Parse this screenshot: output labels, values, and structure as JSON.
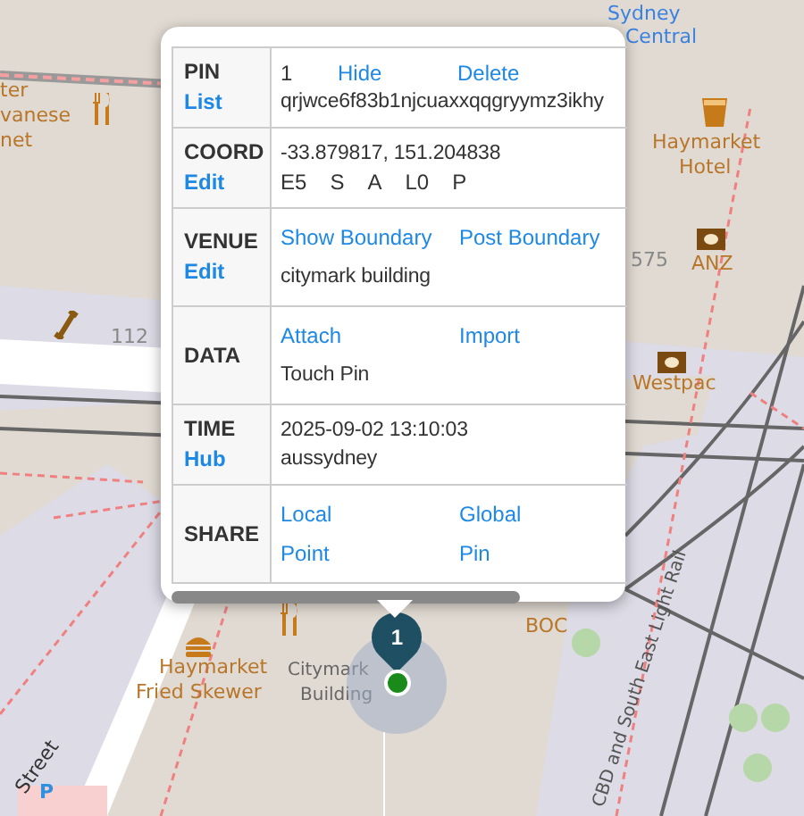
{
  "map_labels": [
    {
      "text": "Sydney",
      "kind": "station"
    },
    {
      "text": "Central",
      "kind": "station"
    },
    {
      "text": "ter",
      "kind": "poi"
    },
    {
      "text": "vanese",
      "kind": "poi"
    },
    {
      "text": "net",
      "kind": "poi"
    },
    {
      "text": "112",
      "kind": "number"
    },
    {
      "text": "Haymarket",
      "kind": "poi"
    },
    {
      "text": "Hotel",
      "kind": "poi"
    },
    {
      "text": "575",
      "kind": "number"
    },
    {
      "text": "ANZ",
      "kind": "poi"
    },
    {
      "text": "Westpac",
      "kind": "poi"
    },
    {
      "text": "BOC",
      "kind": "poi"
    },
    {
      "text": "Haymarket",
      "kind": "poi"
    },
    {
      "text": "Fried Skewer",
      "kind": "poi"
    },
    {
      "text": "Citymark",
      "kind": "building"
    },
    {
      "text": "Building",
      "kind": "building"
    },
    {
      "text": "P",
      "kind": "parking"
    }
  ],
  "street_labels": [
    {
      "text": "Street",
      "kind": "street"
    },
    {
      "text": "CBD and South East Light Rail",
      "kind": "rail"
    }
  ],
  "pin": {
    "number": "1"
  },
  "popup": {
    "rows": [
      {
        "label": "PIN",
        "link": "List",
        "lines": [
          [
            {
              "text": "1",
              "kind": "num"
            },
            {
              "text": "Hide",
              "kind": "action"
            },
            {
              "text": "Delete",
              "kind": "action"
            }
          ],
          [
            {
              "text": "qrjwce6f83b1njcuaxxqqgryymz3ikhy",
              "kind": "text"
            }
          ]
        ]
      },
      {
        "label": "COORD",
        "link": "Edit",
        "lines": [
          [
            {
              "text": "-33.879817, 151.204838",
              "kind": "text"
            }
          ],
          [
            {
              "text": "E5",
              "kind": "code"
            },
            {
              "text": "S",
              "kind": "code"
            },
            {
              "text": "A",
              "kind": "code"
            },
            {
              "text": "L0",
              "kind": "code"
            },
            {
              "text": "P",
              "kind": "code"
            }
          ]
        ]
      },
      {
        "label": "VENUE",
        "link": "Edit",
        "lines": [
          [
            {
              "text": "Show Boundary",
              "kind": "link"
            },
            {
              "text": "Post Boundary",
              "kind": "link"
            }
          ],
          [
            {
              "text": "citymark building",
              "kind": "text"
            }
          ]
        ]
      },
      {
        "label": "DATA",
        "lines": [
          [
            {
              "text": "Attach",
              "kind": "link"
            },
            {
              "text": "Import",
              "kind": "link"
            }
          ],
          [
            {
              "text": "Touch Pin",
              "kind": "text"
            }
          ]
        ]
      },
      {
        "label": "TIME",
        "link": "Hub",
        "lines": [
          [
            {
              "text": "2025-09-02 13:10:03",
              "kind": "text"
            }
          ],
          [
            {
              "text": "aussydney",
              "kind": "text"
            }
          ]
        ]
      },
      {
        "label": "SHARE",
        "lines": [
          [
            {
              "text": "Local",
              "kind": "link"
            },
            {
              "text": "Global",
              "kind": "link"
            }
          ],
          [
            {
              "text": "Point",
              "kind": "link"
            },
            {
              "text": "Pin",
              "kind": "link"
            }
          ]
        ]
      }
    ]
  }
}
